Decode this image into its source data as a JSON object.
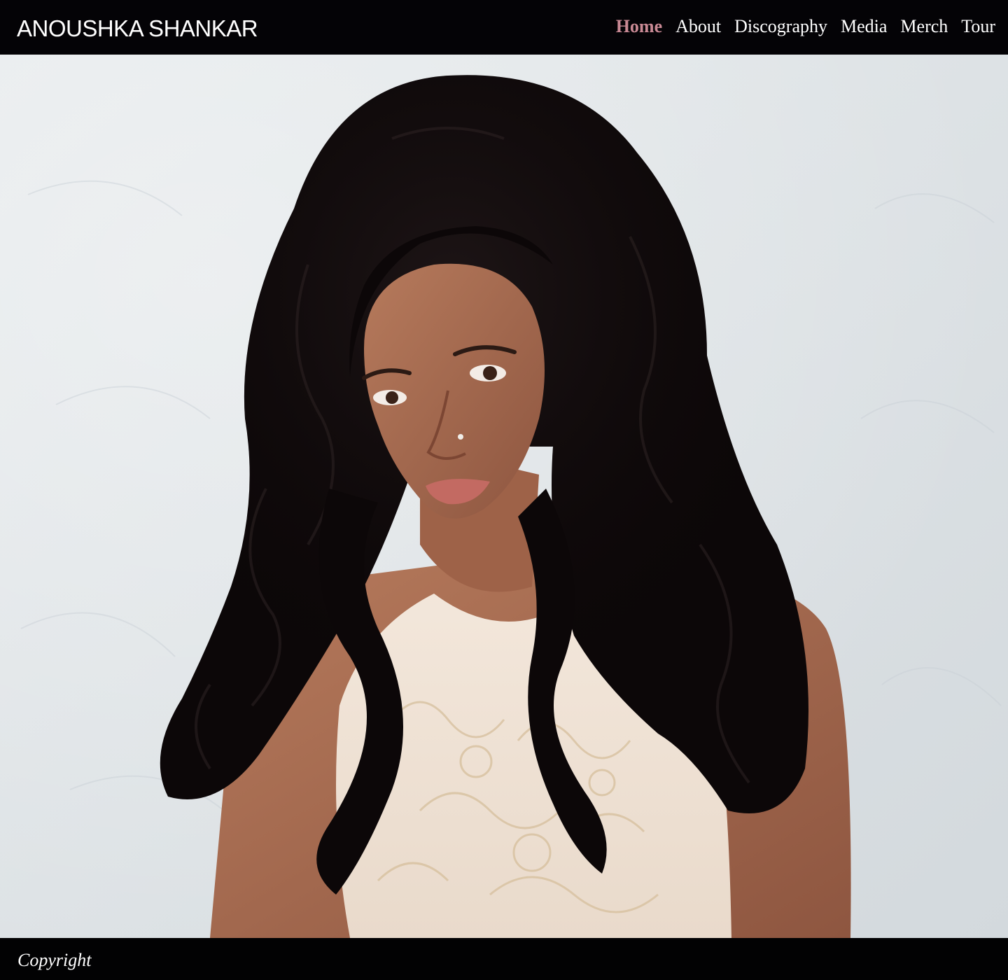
{
  "header": {
    "logo": "ANOUSHKA SHANKAR",
    "nav": [
      {
        "label": "Home",
        "active": true
      },
      {
        "label": "About",
        "active": false
      },
      {
        "label": "Discography",
        "active": false
      },
      {
        "label": "Media",
        "active": false
      },
      {
        "label": "Merch",
        "active": false
      },
      {
        "label": "Tour",
        "active": false
      }
    ]
  },
  "hero": {
    "slide_count": 3,
    "active_slide": 1
  },
  "footer": {
    "copyright_label": "Copyright"
  },
  "colors": {
    "header_bg": "#040306",
    "active_nav": "#c98994",
    "footer_bg": "#020203",
    "wall": "#dfe4e7",
    "hair": "#0c0708",
    "skin": "#a86b50",
    "dress": "#efe1d3"
  }
}
